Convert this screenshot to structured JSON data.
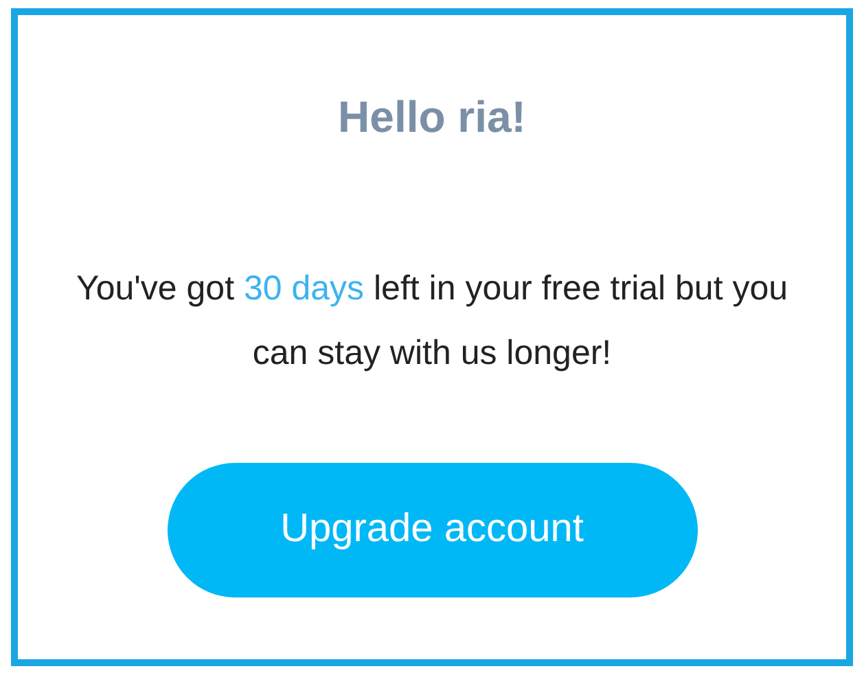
{
  "greeting": "Hello ria!",
  "message": {
    "before": "You've got ",
    "highlight": "30 days",
    "after": " left in your free trial but you can stay with us longer!"
  },
  "button": {
    "label": "Upgrade account"
  }
}
